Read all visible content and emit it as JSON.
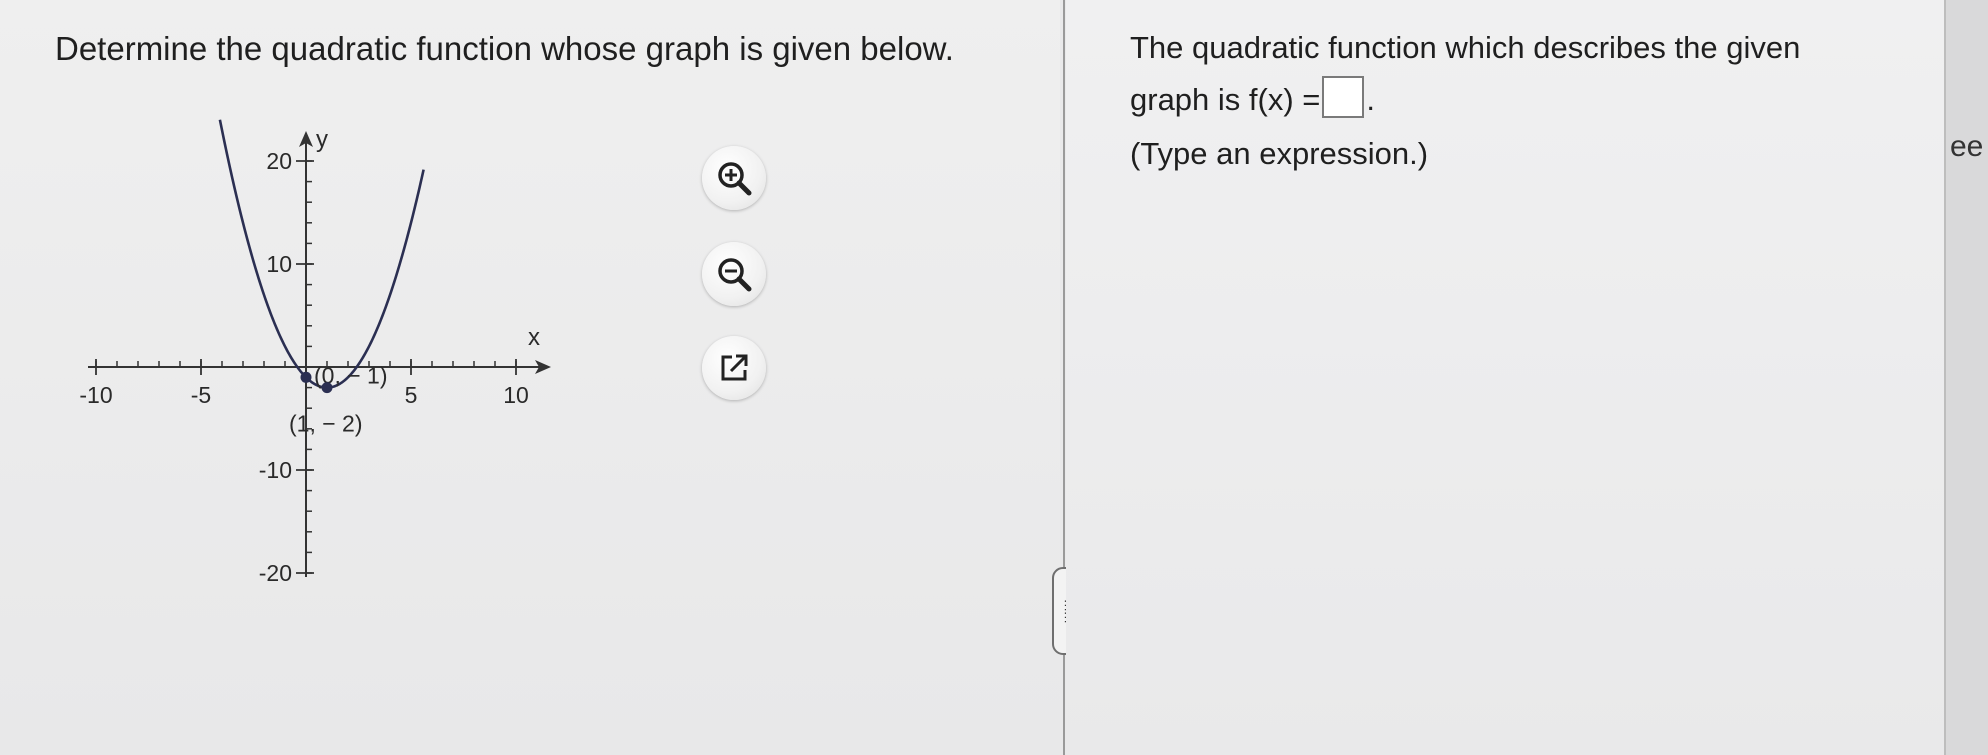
{
  "question": {
    "prompt": "Determine the quadratic function whose graph is given below."
  },
  "graph": {
    "x_label": "x",
    "y_label": "y",
    "x_ticks": [
      {
        "value": -10,
        "label": "-10"
      },
      {
        "value": -5,
        "label": "-5"
      },
      {
        "value": 5,
        "label": "5"
      },
      {
        "value": 10,
        "label": "10"
      }
    ],
    "y_ticks": [
      {
        "value": 20,
        "label": "20"
      },
      {
        "value": 10,
        "label": "10"
      },
      {
        "value": -10,
        "label": "-10"
      },
      {
        "value": -20,
        "label": "-20"
      }
    ],
    "x_range": [
      -10,
      10
    ],
    "y_range": [
      -20,
      20
    ],
    "curve": {
      "a": 1,
      "h": 1,
      "k": -2,
      "x_from": -4.1,
      "x_to": 5.6
    },
    "points": [
      {
        "x": 0,
        "y": -1,
        "label": "(0, − 1)"
      },
      {
        "x": 1,
        "y": -2,
        "label": "(1, − 2)"
      }
    ],
    "curve_color": "#2b2f52"
  },
  "tools": {
    "zoom_in": "zoom-in-icon",
    "zoom_out": "zoom-out-icon",
    "popout": "external-link-icon"
  },
  "splitter": {
    "glyph": "⋯⋯"
  },
  "answer": {
    "line1": "The quadratic function which describes the given",
    "line2_prefix": "graph is f(x) =",
    "line2_suffix": ".",
    "hint": "(Type an expression.)"
  },
  "right_strip": {
    "text": "ee"
  }
}
